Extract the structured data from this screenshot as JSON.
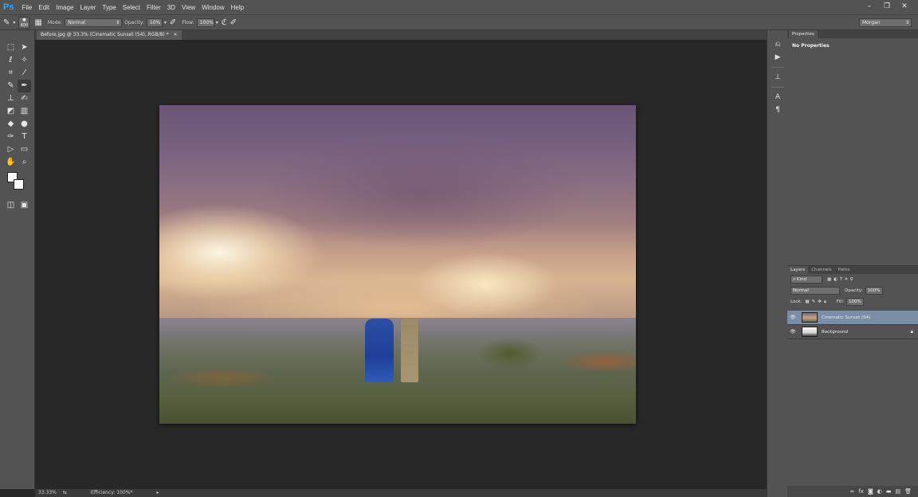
{
  "app": {
    "logo": "Ps"
  },
  "menu": [
    "File",
    "Edit",
    "Image",
    "Layer",
    "Type",
    "Select",
    "Filter",
    "3D",
    "View",
    "Window",
    "Help"
  ],
  "window_controls": {
    "minimize": "–",
    "restore": "❐",
    "close": "✕"
  },
  "options": {
    "brush_size": "400",
    "mode_label": "Mode:",
    "mode_value": "Normal",
    "opacity_label": "Opacity:",
    "opacity_value": "10%",
    "flow_label": "Flow:",
    "flow_value": "100%",
    "workspace": "Morgan"
  },
  "document": {
    "tab_title": "Before.jpg @ 33.3% (Cinematic Sunset (54), RGB/8) *",
    "tab_close": "×"
  },
  "status": {
    "zoom": "33.33%",
    "efficiency": "Efficiency: 100%*"
  },
  "properties": {
    "tab": "Properties",
    "title": "No Properties"
  },
  "layers": {
    "tabs": [
      "Layers",
      "Channels",
      "Paths"
    ],
    "kind": "Kind",
    "blend_mode": "Normal",
    "opacity_label": "Opacity:",
    "opacity_value": "100%",
    "lock_label": "Lock:",
    "fill_label": "Fill:",
    "fill_value": "100%",
    "items": [
      {
        "name": "Cinematic Sunset (54)",
        "selected": true
      },
      {
        "name": "Background",
        "selected": false
      }
    ]
  }
}
